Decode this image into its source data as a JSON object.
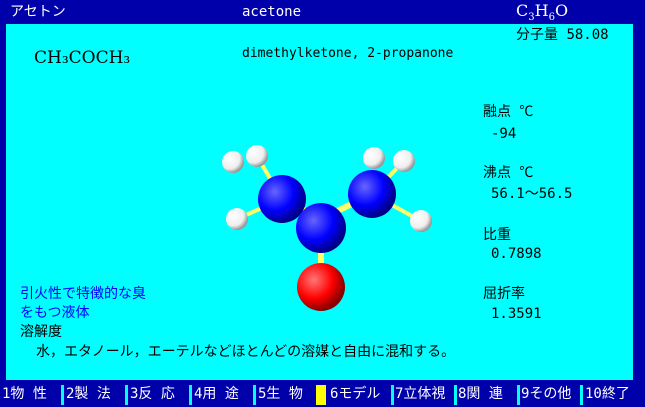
{
  "header": {
    "name_ja": "アセトン",
    "name_en": "acetone",
    "formula_prefix": "C",
    "formula_c_sub": "3",
    "formula_h": "H",
    "formula_h_sub": "6",
    "formula_o": "O",
    "mw_label": "分子量",
    "mw_value": "58.08"
  },
  "main": {
    "structural_formula": "CH₃COCH₃",
    "synonyms": "dimethylketone, 2-propanone",
    "melting_label": "融点 ℃",
    "melting_value": "-94",
    "boiling_label": "沸点 ℃",
    "boiling_value": "56.1～56.5",
    "gravity_label": "比重",
    "gravity_value": "0.7898",
    "refractive_label": "屈折率",
    "refractive_value": "1.3591",
    "description_line1": "引火性で特徴的な臭",
    "description_line2": "をもつ液体",
    "solubility_label": "溶解度",
    "solubility_text": "水，エタノール，エーテルなどほとんどの溶媒と自由に混和する。"
  },
  "fkeys": [
    {
      "label": "1物 性"
    },
    {
      "label": "2製 法"
    },
    {
      "label": "3反 応"
    },
    {
      "label": "4用 途"
    },
    {
      "label": "5生 物"
    },
    {
      "label": "6モデル"
    },
    {
      "label": "7立体視"
    },
    {
      "label": "8関 連"
    },
    {
      "label": "9その他"
    },
    {
      "label": "10終了"
    }
  ],
  "colors": {
    "background": "#00ffff",
    "frame": "#0000aa",
    "carbon": "#0000ff",
    "hydrogen": "#ffffff",
    "oxygen": "#ff0000",
    "bond": "#ffff66",
    "accent_text": "#0000ff",
    "active_key": "#ffff00"
  }
}
